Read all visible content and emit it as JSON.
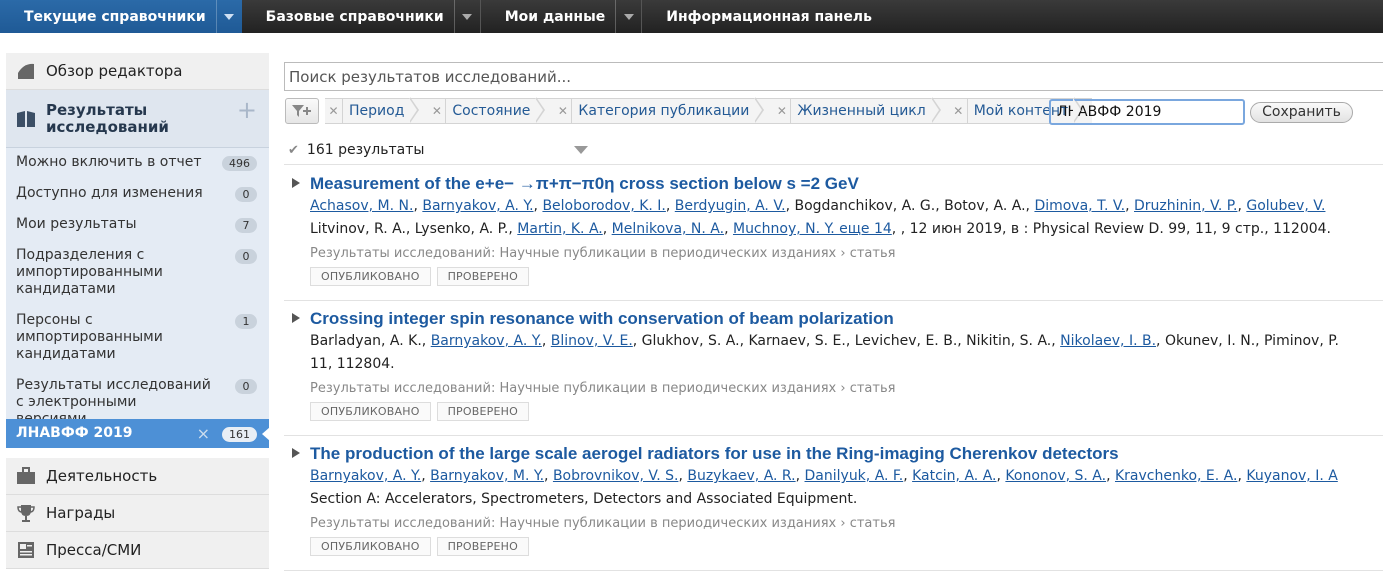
{
  "topnav": {
    "tabs": [
      {
        "label": "Текущие справочники"
      },
      {
        "label": "Базовые справочники"
      },
      {
        "label": "Мои данные"
      },
      {
        "label": "Информационная панель"
      }
    ]
  },
  "sidebar": {
    "overview": "Обзор редактора",
    "research_head": "Результаты исследований",
    "items": [
      {
        "label": "Можно включить в отчет",
        "count": "496"
      },
      {
        "label": "Доступно для изменения",
        "count": "0"
      },
      {
        "label": "Мои результаты",
        "count": "7"
      },
      {
        "label": "Подразделения с импортированными кандидатами",
        "count": "0"
      },
      {
        "label": "Персоны с импортированными кандидатами",
        "count": "1"
      },
      {
        "label": "Результаты исследований с электронными версиями",
        "count": "0"
      }
    ],
    "selected": {
      "label": "ЛНАВФФ 2019",
      "remove": "×",
      "count": "161"
    },
    "activity": "Деятельность",
    "awards": "Награды",
    "press": "Пресса/СМИ"
  },
  "search": {
    "placeholder": "Поиск результатов исследований..."
  },
  "filters": {
    "chips": [
      "Период",
      "Состояние",
      "Категория публикации",
      "Жизненный цикл",
      "Мой контент"
    ],
    "save_name": "ЛНАВФФ 2019",
    "save_label": "Сохранить"
  },
  "results_count": "161 результаты",
  "results": [
    {
      "title": "Measurement of the e+e− →π+π−π0η cross section below s =2 GeV",
      "line1": [
        {
          "t": "Achasov, M. N.",
          "link": true
        },
        {
          "t": ", "
        },
        {
          "t": "Barnyakov, A. Y.",
          "link": true
        },
        {
          "t": ", "
        },
        {
          "t": "Beloborodov, K. I.",
          "link": true
        },
        {
          "t": ", "
        },
        {
          "t": "Berdyugin, A. V.",
          "link": true
        },
        {
          "t": ", Bogdanchikov, A. G., Botov, A. A., "
        },
        {
          "t": "Dimova, T. V.",
          "link": true
        },
        {
          "t": ", "
        },
        {
          "t": "Druzhinin, V. P.",
          "link": true
        },
        {
          "t": ", "
        },
        {
          "t": "Golubev, V.",
          "link": true
        }
      ],
      "line2": [
        {
          "t": "Litvinov, R. A., Lysenko, A. P., "
        },
        {
          "t": "Martin, K. A.",
          "link": true
        },
        {
          "t": ", "
        },
        {
          "t": "Melnikova, N. A.",
          "link": true
        },
        {
          "t": ", "
        },
        {
          "t": "Muchnoy, N. Y. еще 14",
          "link": true
        },
        {
          "t": ", , 12 июн 2019, в : Physical Review D. 99, 11, 9 стр., 112004."
        }
      ],
      "path": "Результаты исследований: Научные публикации в периодических изданиях › статья",
      "status1": "ОПУБЛИКОВАНО",
      "status2": "ПРОВЕРЕНО"
    },
    {
      "title": "Crossing integer spin resonance with conservation of beam polarization",
      "line1": [
        {
          "t": "Barladyan, A. K., "
        },
        {
          "t": "Barnyakov, A. Y.",
          "link": true
        },
        {
          "t": ", "
        },
        {
          "t": "Blinov, V. E.",
          "link": true
        },
        {
          "t": ", Glukhov, S. A., Karnaev, S. E., Levichev, E. B., Nikitin, S. A., "
        },
        {
          "t": "Nikolaev, I. B.",
          "link": true
        },
        {
          "t": ", Okunev, I. N., Piminov, P. "
        }
      ],
      "line2": [
        {
          "t": "11, 112804."
        }
      ],
      "path": "Результаты исследований: Научные публикации в периодических изданиях › статья",
      "status1": "ОПУБЛИКОВАНО",
      "status2": "ПРОВЕРЕНО"
    },
    {
      "title": "The production of the large scale aerogel radiators for use in the Ring-imaging Cherenkov detectors",
      "line1": [
        {
          "t": "Barnyakov, A. Y.",
          "link": true
        },
        {
          "t": ", "
        },
        {
          "t": "Barnyakov, M. Y.",
          "link": true
        },
        {
          "t": ", "
        },
        {
          "t": "Bobrovnikov, V. S.",
          "link": true
        },
        {
          "t": ", "
        },
        {
          "t": "Buzykaev, A. R.",
          "link": true
        },
        {
          "t": ", "
        },
        {
          "t": "Danilyuk, A. F.",
          "link": true
        },
        {
          "t": ", "
        },
        {
          "t": "Katcin, A. A.",
          "link": true
        },
        {
          "t": ", "
        },
        {
          "t": "Kononov, S. A.",
          "link": true
        },
        {
          "t": ", "
        },
        {
          "t": "Kravchenko, E. A.",
          "link": true
        },
        {
          "t": ", "
        },
        {
          "t": "Kuyanov, I. A",
          "link": true
        }
      ],
      "line2": [
        {
          "t": "Section A: Accelerators, Spectrometers, Detectors and Associated Equipment."
        }
      ],
      "path": "Результаты исследований: Научные публикации в периодических изданиях › статья",
      "status1": "ОПУБЛИКОВАНО",
      "status2": "ПРОВЕРЕНО"
    }
  ]
}
